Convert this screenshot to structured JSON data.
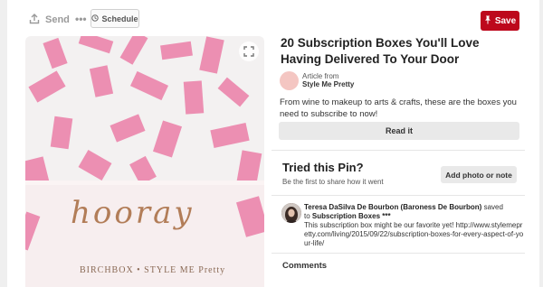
{
  "toolbar": {
    "send_label": "Send",
    "more_label": "•••",
    "schedule_label": "Schedule",
    "save_label": "Save",
    "accent_color": "#bd081c"
  },
  "image": {
    "box_text": "hooray",
    "brand_text": "BIRCHBOX • STYLE ME Pretty",
    "expand_icon": "expand-icon"
  },
  "pin": {
    "title": "20 Subscription Boxes You'll Love Having Delivered To Your Door",
    "source_prefix": "Article from",
    "source_name": "Style Me Pretty",
    "description": "From wine to makeup to arts & crafts, these are the boxes you need to subscribe to now!",
    "read_label": "Read it"
  },
  "tried": {
    "title": "Tried this Pin?",
    "subtitle": "Be the first to share how it went",
    "add_photo_label": "Add photo or note"
  },
  "saver": {
    "name": "Teresa DaSilva De Bourbon (Baroness De Bourbon)",
    "action": "saved",
    "to_word": "to",
    "board": "Subscription Boxes ***",
    "note": "This subscription box might be our favorite yet! http://www.stylemepretty.com/living/2015/09/22/subscription-boxes-for-every-aspect-of-your-life/"
  },
  "comments": {
    "title": "Comments"
  }
}
